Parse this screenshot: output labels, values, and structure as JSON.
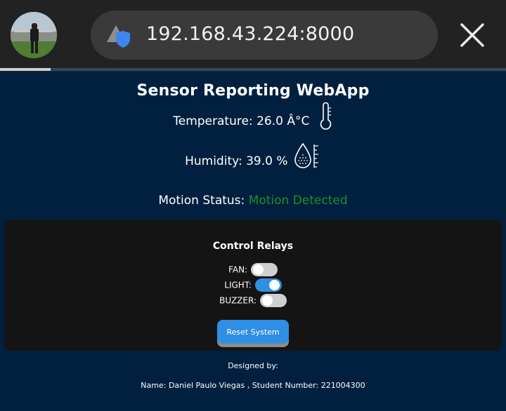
{
  "browser": {
    "url": "192.168.43.224:8000",
    "load_progress": 0.1
  },
  "page": {
    "title": "Sensor Reporting WebApp",
    "temperature_text": "Temperature: 26.0 Â°C",
    "humidity_text": "Humidity: 39.0 %",
    "motion_label": "Motion Status: ",
    "motion_value": "Motion Detected",
    "motion_color": "#1e8f29"
  },
  "controls": {
    "title": "Control Relays",
    "relays": [
      {
        "label": "FAN:",
        "on": false
      },
      {
        "label": "LIGHT:",
        "on": true
      },
      {
        "label": "BUZZER:",
        "on": false
      }
    ],
    "reset_label": "Reset System",
    "accent": "#2f8fe4"
  },
  "footer": {
    "designed_by": "Designed by:",
    "credits": "Name: Daniel Paulo Viegas , Student Number: 221004300"
  },
  "icons": {
    "site": "site-info-shield-icon",
    "close": "close-icon",
    "temperature": "thermometer-icon",
    "humidity": "droplet-gauge-icon"
  }
}
